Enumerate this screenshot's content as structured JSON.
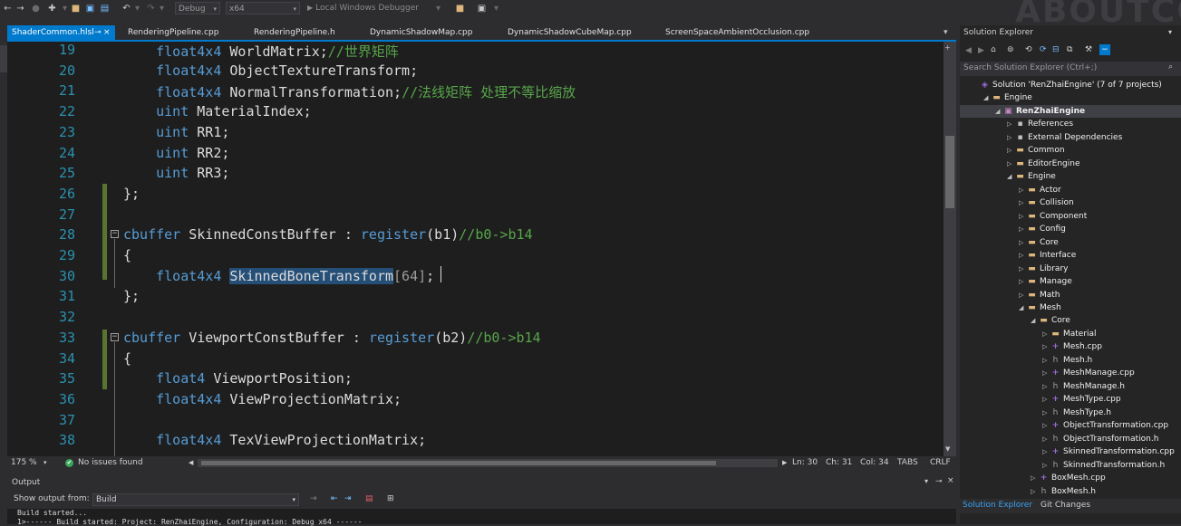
{
  "toolbar": {
    "config_value": "Debug",
    "platform_value": "x64",
    "run_label": "Local Windows Debugger",
    "brand_text": "ABOUTCG"
  },
  "tabs": [
    {
      "label": "ShaderCommon.hlsl",
      "active": true
    },
    {
      "label": "RenderingPipeline.cpp"
    },
    {
      "label": "RenderingPipeline.h"
    },
    {
      "label": "DynamicShadowMap.cpp"
    },
    {
      "label": "DynamicShadowCubeMap.cpp"
    },
    {
      "label": "ScreenSpaceAmbientOcclusion.cpp"
    }
  ],
  "tab_pin": "⊸",
  "tab_close": "×",
  "tab_dropdown": "▾",
  "editor": {
    "lines": [
      {
        "n": "19",
        "a": "    float4x4 ",
        "b": "WorldMatrix;",
        "c": "//世界矩阵"
      },
      {
        "n": "20",
        "a": "    float4x4 ",
        "b": "ObjectTextureTransform;"
      },
      {
        "n": "21",
        "a": "    float4x4 ",
        "b": "NormalTransformation;",
        "c": "//法线矩阵 处理不等比缩放"
      },
      {
        "n": "22",
        "a": "    uint ",
        "b": "MaterialIndex;"
      },
      {
        "n": "23",
        "a": "    uint ",
        "b": "RR1;"
      },
      {
        "n": "24",
        "a": "    uint ",
        "b": "RR2;"
      },
      {
        "n": "25",
        "a": "    uint ",
        "b": "RR3;"
      },
      {
        "n": "26",
        "b": "};"
      },
      {
        "n": "27"
      },
      {
        "n": "28",
        "a": "cbuffer ",
        "b": "SkinnedConstBuffer : ",
        "d": "register",
        "e": "(b1)",
        "c": "//b0->b14"
      },
      {
        "n": "29",
        "b": "{"
      },
      {
        "n": "30",
        "a": "    float4x4 ",
        "sel": "SkinnedBoneTransform",
        "f": "[64]",
        "b": ";"
      },
      {
        "n": "31",
        "b": "};"
      },
      {
        "n": "32"
      },
      {
        "n": "33",
        "a": "cbuffer ",
        "b": "ViewportConstBuffer : ",
        "d": "register",
        "e": "(b2)",
        "c": "//b0->b14"
      },
      {
        "n": "34",
        "b": "{"
      },
      {
        "n": "35",
        "a": "    float4 ",
        "b": "ViewportPosition;"
      },
      {
        "n": "36",
        "a": "    float4x4 ",
        "b": "ViewProjectionMatrix;"
      },
      {
        "n": "37"
      },
      {
        "n": "38",
        "a": "    float4x4 ",
        "b": "TexViewProjectionMatrix;"
      }
    ]
  },
  "status": {
    "zoom": "175 %",
    "issues": "No issues found",
    "ln": "Ln: 30",
    "ch": "Ch: 31",
    "col": "Col: 34",
    "tabs": "TABS",
    "eol": "CRLF"
  },
  "output": {
    "title": "Output",
    "show_from_label": "Show output from:",
    "source": "Build",
    "line1": "Build started...",
    "line2": "1>------ Build started: Project: RenZhaiEngine, Configuration: Debug x64 ------"
  },
  "solution_explorer": {
    "title": "Solution Explorer",
    "search_placeholder": "Search Solution Explorer (Ctrl+;)",
    "bottom_tab_1": "Solution Explorer",
    "bottom_tab_2": "Git Changes",
    "tree": [
      {
        "label": "Solution 'RenZhaiEngine' (7 of 7 projects)",
        "depth": 0,
        "icon": "sln",
        "tw": ""
      },
      {
        "label": "Engine",
        "depth": 1,
        "icon": "folder",
        "tw": "open"
      },
      {
        "label": "RenZhaiEngine",
        "depth": 2,
        "icon": "proj",
        "tw": "open",
        "bold": true,
        "selected": true
      },
      {
        "label": "References",
        "depth": 3,
        "icon": "ref",
        "tw": "closed"
      },
      {
        "label": "External Dependencies",
        "depth": 3,
        "icon": "ref",
        "tw": "closed"
      },
      {
        "label": "Common",
        "depth": 3,
        "icon": "folder",
        "tw": "closed"
      },
      {
        "label": "EditorEngine",
        "depth": 3,
        "icon": "folder",
        "tw": "closed"
      },
      {
        "label": "Engine",
        "depth": 3,
        "icon": "folder",
        "tw": "open"
      },
      {
        "label": "Actor",
        "depth": 4,
        "icon": "folder",
        "tw": "closed"
      },
      {
        "label": "Collision",
        "depth": 4,
        "icon": "folder",
        "tw": "closed"
      },
      {
        "label": "Component",
        "depth": 4,
        "icon": "folder",
        "tw": "closed"
      },
      {
        "label": "Config",
        "depth": 4,
        "icon": "folder",
        "tw": "closed"
      },
      {
        "label": "Core",
        "depth": 4,
        "icon": "folder",
        "tw": "closed"
      },
      {
        "label": "Interface",
        "depth": 4,
        "icon": "folder",
        "tw": "closed"
      },
      {
        "label": "Library",
        "depth": 4,
        "icon": "folder",
        "tw": "closed"
      },
      {
        "label": "Manage",
        "depth": 4,
        "icon": "folder",
        "tw": "closed"
      },
      {
        "label": "Math",
        "depth": 4,
        "icon": "folder",
        "tw": "closed"
      },
      {
        "label": "Mesh",
        "depth": 4,
        "icon": "folder",
        "tw": "open"
      },
      {
        "label": "Core",
        "depth": 5,
        "icon": "folder",
        "tw": "open"
      },
      {
        "label": "Material",
        "depth": 6,
        "icon": "folder",
        "tw": "closed"
      },
      {
        "label": "Mesh.cpp",
        "depth": 6,
        "icon": "cpp",
        "tw": "closed"
      },
      {
        "label": "Mesh.h",
        "depth": 6,
        "icon": "h",
        "tw": "closed"
      },
      {
        "label": "MeshManage.cpp",
        "depth": 6,
        "icon": "cpp",
        "tw": "closed"
      },
      {
        "label": "MeshManage.h",
        "depth": 6,
        "icon": "h",
        "tw": "closed"
      },
      {
        "label": "MeshType.cpp",
        "depth": 6,
        "icon": "cpp",
        "tw": "closed"
      },
      {
        "label": "MeshType.h",
        "depth": 6,
        "icon": "h",
        "tw": "closed"
      },
      {
        "label": "ObjectTransformation.cpp",
        "depth": 6,
        "icon": "cpp",
        "tw": "closed"
      },
      {
        "label": "ObjectTransformation.h",
        "depth": 6,
        "icon": "h",
        "tw": "closed"
      },
      {
        "label": "SkinnedTransformation.cpp",
        "depth": 6,
        "icon": "cpp",
        "tw": "closed"
      },
      {
        "label": "SkinnedTransformation.h",
        "depth": 6,
        "icon": "h",
        "tw": "closed"
      },
      {
        "label": "BoxMesh.cpp",
        "depth": 5,
        "icon": "cpp",
        "tw": "closed"
      },
      {
        "label": "BoxMesh.h",
        "depth": 5,
        "icon": "h",
        "tw": "closed"
      }
    ]
  },
  "icons": {
    "back": "←",
    "forward": "→",
    "new": "✚",
    "open": "📂",
    "save": "▣",
    "saveall": "▤",
    "undo": "↶",
    "redo": "↷",
    "run": "▶",
    "check": "✔",
    "gear": "⚙",
    "home": "⌂",
    "search": "⌕",
    "refresh": "⟳",
    "wrench": "🔧",
    "pin": "⊸",
    "close": "×"
  },
  "colors": {
    "accent": "#007acc",
    "keyword": "#569cd6",
    "comment": "#57a64a",
    "line_number": "#2b91af",
    "selection": "#264f78",
    "change_bar": "#577430"
  }
}
